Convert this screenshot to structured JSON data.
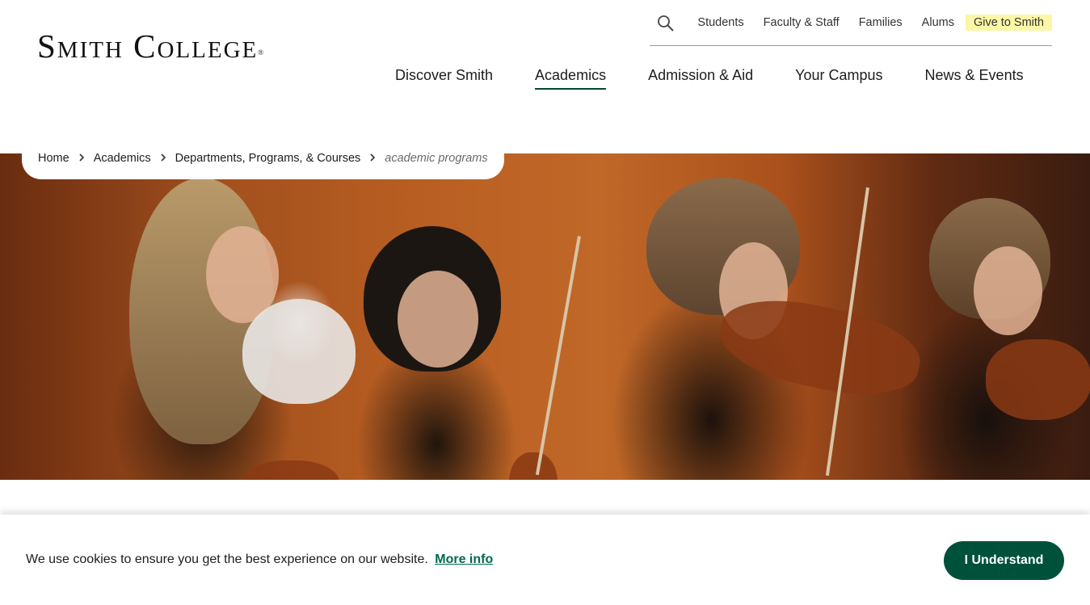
{
  "header": {
    "logo_text": "Smith College",
    "logo_reg": "®"
  },
  "utility_nav": {
    "search_icon": "search-icon",
    "links": [
      "Students",
      "Faculty & Staff",
      "Families",
      "Alums"
    ],
    "give_label": "Give to Smith",
    "give_highlight": "#fbf7a6"
  },
  "main_nav": {
    "items": [
      "Discover Smith",
      "Academics",
      "Admission & Aid",
      "Your Campus",
      "News & Events"
    ],
    "active": "Academics",
    "accent": "#004833"
  },
  "breadcrumb": {
    "items": [
      "Home",
      "Academics",
      "Departments, Programs, & Courses"
    ],
    "current": "academic programs",
    "separator_icon": "chevron-right-icon"
  },
  "hero": {
    "image": "orchestra-string-players"
  },
  "cookie_banner": {
    "message": "We use cookies to ensure you get the best experience on our website.",
    "link_label": "More info",
    "button_label": "I Understand",
    "button_color": "#00513a"
  }
}
